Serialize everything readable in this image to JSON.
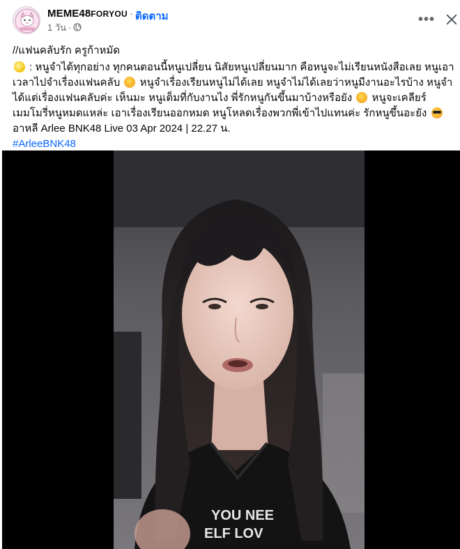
{
  "header": {
    "page_name": "MEME48",
    "page_name_suffix": "Foryou",
    "follow_separator": "·",
    "follow_label": "ติดตาม",
    "time": "1 วัน",
    "time_separator": "·",
    "privacy_icon": "globe-icon",
    "more_icon": "more-dots-icon",
    "more_label": "•••",
    "close_icon": "close-icon"
  },
  "post": {
    "title": "//แฟนคลับรัก ครูก้าหมัด",
    "paragraph_prefix": " : หนูจำได้ทุกอย่าง ทุกคนตอนนี้หนูเปลี่ยน นิสัยหนูเปลี่ยนมาก คือหนูจะไม่เรียนหนังสือเลย หนูเอาเวลาไปจำเรื่องแฟนคลับ ",
    "paragraph_mid1": " หนูจำเรื่องเรียนหนูไม่ได้เลย หนูจำไม่ได้เลยว่าหนูมีงานอะไรบ้าง หนูจำได้แต่เรื่องแฟนคลับค่ะ เห็นมะ หนูเต็มที่กับงานไง พี่รักหนูกันขึ้นมาบ้างหรือยัง ",
    "paragraph_mid2": " หนูจะเคลียร์เมมโมรี่หนูหมดแหล่ะ เอาเรื่องเรียนออกหมด หนูโหลดเรื่องพวกพี่เข้าไปแทนค่ะ รักหนูขึ้นอะยัง ",
    "caption": "อาหลี Arlee BNK48 Live 03 Apr 2024 | 22.27 น.",
    "hashtag": "#ArleeBNK48",
    "emoji": [
      "lemon-emoji",
      "laughing-emoji",
      "laughing-emoji",
      "sunglasses-emoji"
    ]
  },
  "video": {
    "shirt_text_line1": "YOU NEE",
    "shirt_text_line2": "ELF LOV"
  },
  "colors": {
    "link_blue": "#0866ff",
    "secondary_text": "#65676b",
    "video_letterbox": "#000000"
  }
}
